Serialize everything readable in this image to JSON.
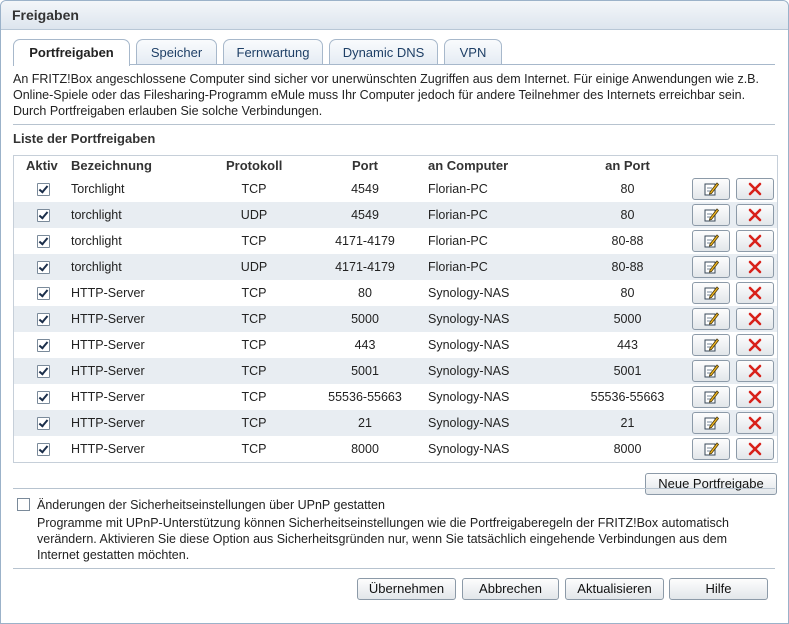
{
  "window": {
    "title": "Freigaben"
  },
  "tabs": [
    {
      "label": "Portfreigaben",
      "active": true
    },
    {
      "label": "Speicher",
      "active": false
    },
    {
      "label": "Fernwartung",
      "active": false
    },
    {
      "label": "Dynamic DNS",
      "active": false
    },
    {
      "label": "VPN",
      "active": false
    }
  ],
  "intro": "An FRITZ!Box angeschlossene Computer sind sicher vor unerwünschten Zugriffen aus dem Internet. Für einige Anwendungen wie z.B. Online-Spiele oder das Filesharing-Programm eMule muss Ihr Computer jedoch für andere Teilnehmer des Internets erreichbar sein. Durch Portfreigaben erlauben Sie solche Verbindungen.",
  "list": {
    "title": "Liste der Portfreigaben",
    "columns": {
      "aktiv": "Aktiv",
      "bezeichnung": "Bezeichnung",
      "protokoll": "Protokoll",
      "port": "Port",
      "computer": "an Computer",
      "anport": "an Port"
    },
    "rows": [
      {
        "name": "Torchlight",
        "proto": "TCP",
        "port": "4549",
        "computer": "Florian-PC",
        "toport": "80",
        "active": true
      },
      {
        "name": "torchlight",
        "proto": "UDP",
        "port": "4549",
        "computer": "Florian-PC",
        "toport": "80",
        "active": true
      },
      {
        "name": "torchlight",
        "proto": "TCP",
        "port": "4171-4179",
        "computer": "Florian-PC",
        "toport": "80-88",
        "active": true
      },
      {
        "name": "torchlight",
        "proto": "UDP",
        "port": "4171-4179",
        "computer": "Florian-PC",
        "toport": "80-88",
        "active": true
      },
      {
        "name": "HTTP-Server",
        "proto": "TCP",
        "port": "80",
        "computer": "Synology-NAS",
        "toport": "80",
        "active": true
      },
      {
        "name": "HTTP-Server",
        "proto": "TCP",
        "port": "5000",
        "computer": "Synology-NAS",
        "toport": "5000",
        "active": true
      },
      {
        "name": "HTTP-Server",
        "proto": "TCP",
        "port": "443",
        "computer": "Synology-NAS",
        "toport": "443",
        "active": true
      },
      {
        "name": "HTTP-Server",
        "proto": "TCP",
        "port": "5001",
        "computer": "Synology-NAS",
        "toport": "5001",
        "active": true
      },
      {
        "name": "HTTP-Server",
        "proto": "TCP",
        "port": "55536-55663",
        "computer": "Synology-NAS",
        "toport": "55536-55663",
        "active": true
      },
      {
        "name": "HTTP-Server",
        "proto": "TCP",
        "port": "21",
        "computer": "Synology-NAS",
        "toport": "21",
        "active": true
      },
      {
        "name": "HTTP-Server",
        "proto": "TCP",
        "port": "8000",
        "computer": "Synology-NAS",
        "toport": "8000",
        "active": true
      }
    ],
    "icons": {
      "edit": "edit-icon",
      "delete": "delete-icon"
    },
    "colors": {
      "delete": "#d8211a",
      "row_alt": "#e8edf2"
    }
  },
  "new_button": "Neue Portfreigabe",
  "upnp": {
    "label": "Änderungen der Sicherheitseinstellungen über UPnP gestatten",
    "checked": false,
    "description": "Programme mit UPnP-Unterstützung können Sicherheitseinstellungen wie die Portfreigaberegeln der FRITZ!Box automatisch verändern. Aktivieren Sie diese Option aus Sicherheitsgründen nur, wenn Sie tatsächlich eingehende Verbindungen aus dem Internet gestatten möchten."
  },
  "footer": {
    "apply": "Übernehmen",
    "cancel": "Abbrechen",
    "refresh": "Aktualisieren",
    "help": "Hilfe"
  }
}
